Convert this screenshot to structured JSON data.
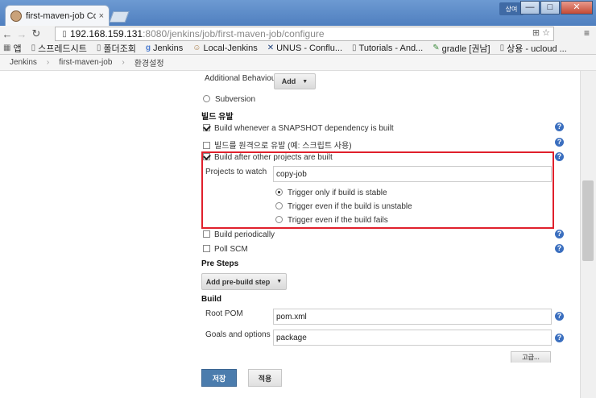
{
  "browser": {
    "tab_title": "first-maven-job Con",
    "tab_close": "×",
    "user_badge": "상여",
    "win_min": "—",
    "win_max": "□",
    "win_close": "✕",
    "url_host": "192.168.159.131",
    "url_path": ":8080/jenkins/job/first-maven-job/configure",
    "bookmarks": [
      {
        "icon": "apps-icon",
        "label": "앱"
      },
      {
        "icon": "page-icon",
        "label": "스프레드시트"
      },
      {
        "icon": "page-icon",
        "label": "폴더조회"
      },
      {
        "icon": "g-icon",
        "label": "Jenkins"
      },
      {
        "icon": "jenkins-icon",
        "label": "Local-Jenkins"
      },
      {
        "icon": "x-icon",
        "label": "UNUS - Conflu..."
      },
      {
        "icon": "page-icon",
        "label": "Tutorials - And..."
      },
      {
        "icon": "gradle-icon",
        "label": "gradle [권남]"
      },
      {
        "icon": "page-icon",
        "label": "상용 - ucloud ..."
      }
    ]
  },
  "breadcrumbs": [
    "Jenkins",
    "first-maven-job",
    "환경설정"
  ],
  "form": {
    "additional_behaviours_label": "Additional Behaviours",
    "add_button": "Add",
    "subversion_label": "Subversion",
    "build_triggers_title": "빌드 유발",
    "trigger_snapshot": "Build whenever a SNAPSHOT dependency is built",
    "trigger_remote": "빌드를 원격으로 유발 (예: 스크립트 사용)",
    "trigger_after_other": "Build after other projects are built",
    "projects_to_watch_label": "Projects to watch",
    "projects_to_watch_value": "copy-job",
    "radio_stable": "Trigger only if build is stable",
    "radio_unstable": "Trigger even if the build is unstable",
    "radio_fails": "Trigger even if the build fails",
    "trigger_periodically": "Build periodically",
    "trigger_poll_scm": "Poll SCM",
    "pre_steps_title": "Pre Steps",
    "add_pre_build_step": "Add pre-build step",
    "build_title": "Build",
    "root_pom_label": "Root POM",
    "root_pom_value": "pom.xml",
    "goals_label": "Goals and options",
    "goals_value": "package",
    "advanced_button": "고급...",
    "save_button": "저장",
    "apply_button": "적용",
    "help_glyph": "?"
  }
}
